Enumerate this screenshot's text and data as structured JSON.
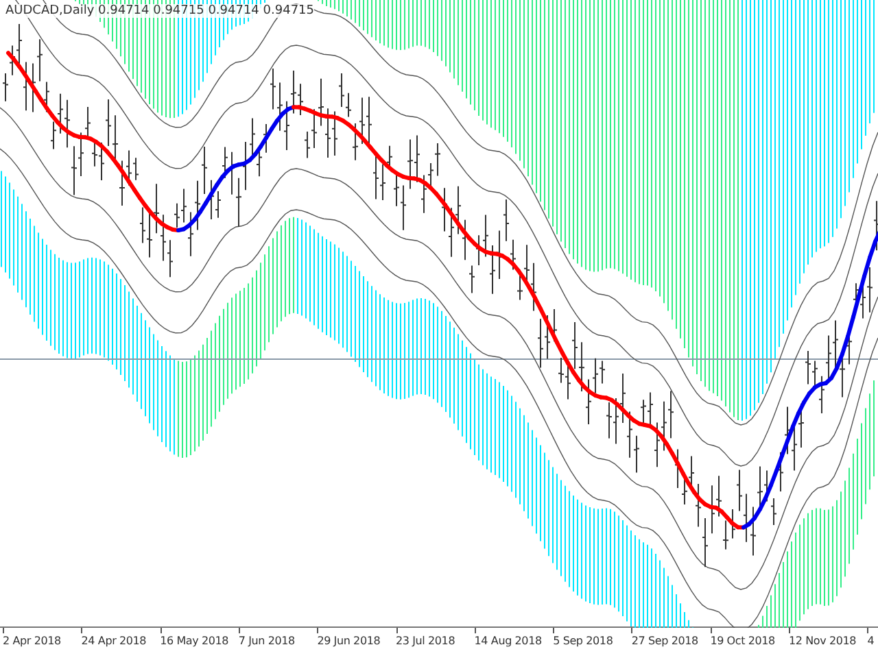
{
  "chart": {
    "title": "AUDCAD,Daily  0.94714 0.94715 0.94714 0.94715"
  },
  "x_axis": {
    "labels": [
      "2 Apr 2018",
      "24 Apr 2018",
      "16 May 2018",
      "7 Jun 2018",
      "29 Jun 2018",
      "23 Jul 2018",
      "14 Aug 2018",
      "5 Sep 2018",
      "27 Sep 2018",
      "19 Oct 2018",
      "12 Nov 2018",
      "4"
    ]
  }
}
